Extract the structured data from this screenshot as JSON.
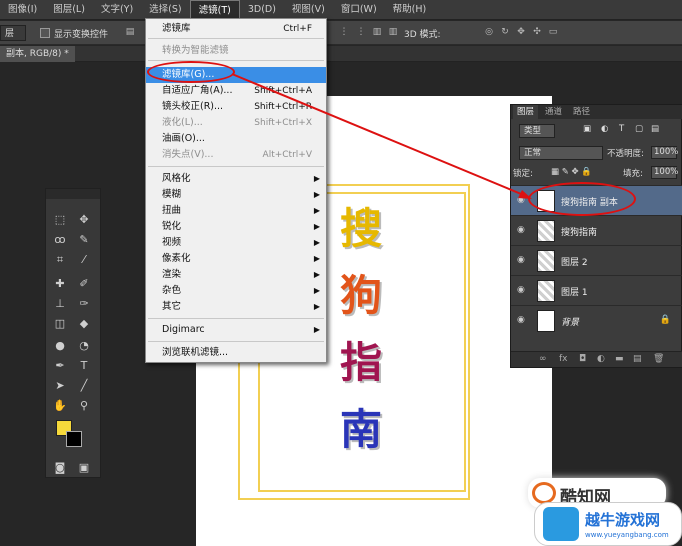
{
  "menubar": {
    "items": [
      "图像(I)",
      "图层(L)",
      "文字(Y)",
      "选择(S)",
      "滤镜(T)",
      "3D(D)",
      "视图(V)",
      "窗口(W)",
      "帮助(H)"
    ]
  },
  "options": {
    "dropdown": "层",
    "show_transform": "显示变换控件",
    "mode_3d": "3D 模式:"
  },
  "doc_tab": "副本, RGB/8) *",
  "filter_menu": {
    "items": [
      {
        "label": "滤镜库",
        "shortcut": "Ctrl+F",
        "state": "normal"
      },
      {
        "label": "转换为智能滤镜",
        "shortcut": "",
        "state": "disabled"
      },
      {
        "label": "滤镜库(G)...",
        "shortcut": "",
        "state": "highlight"
      },
      {
        "label": "自适应广角(A)...",
        "shortcut": "Shift+Ctrl+A",
        "state": "normal"
      },
      {
        "label": "镜头校正(R)...",
        "shortcut": "Shift+Ctrl+R",
        "state": "normal"
      },
      {
        "label": "液化(L)...",
        "shortcut": "Shift+Ctrl+X",
        "state": "disabled"
      },
      {
        "label": "油画(O)...",
        "shortcut": "",
        "state": "normal"
      },
      {
        "label": "消失点(V)...",
        "shortcut": "Alt+Ctrl+V",
        "state": "disabled"
      },
      {
        "label": "风格化",
        "submenu": true
      },
      {
        "label": "模糊",
        "submenu": true
      },
      {
        "label": "扭曲",
        "submenu": true
      },
      {
        "label": "锐化",
        "submenu": true
      },
      {
        "label": "视频",
        "submenu": true
      },
      {
        "label": "像素化",
        "submenu": true
      },
      {
        "label": "渲染",
        "submenu": true
      },
      {
        "label": "杂色",
        "submenu": true
      },
      {
        "label": "其它",
        "submenu": true
      },
      {
        "label": "Digimarc",
        "submenu": true
      },
      {
        "label": "浏览联机滤镜...",
        "shortcut": "",
        "state": "normal"
      }
    ]
  },
  "canvas": {
    "chars": [
      "搜",
      "狗",
      "指",
      "南"
    ]
  },
  "layers_panel": {
    "tabs": [
      "图层",
      "通道",
      "路径"
    ],
    "kind_filter": "类型",
    "blend_mode": "正常",
    "opacity_label": "不透明度:",
    "opacity": "100%",
    "lock_label": "锁定:",
    "fill_label": "填充:",
    "fill": "100%",
    "layers": [
      {
        "name": "搜狗指南 副本",
        "selected": true
      },
      {
        "name": "搜狗指南",
        "selected": false
      },
      {
        "name": "图层 2",
        "selected": false
      },
      {
        "name": "图层 1",
        "selected": false
      },
      {
        "name": "背景",
        "selected": false
      }
    ]
  },
  "watermarks": {
    "brand1": "酷知网",
    "brand2": "越牛游戏网",
    "url2": "www.yueyangbang.com"
  },
  "colors": {
    "foreground": "#f6d93b",
    "background": "#000000",
    "highlight": "#3a8ee6",
    "annotation": "#dd1111"
  }
}
